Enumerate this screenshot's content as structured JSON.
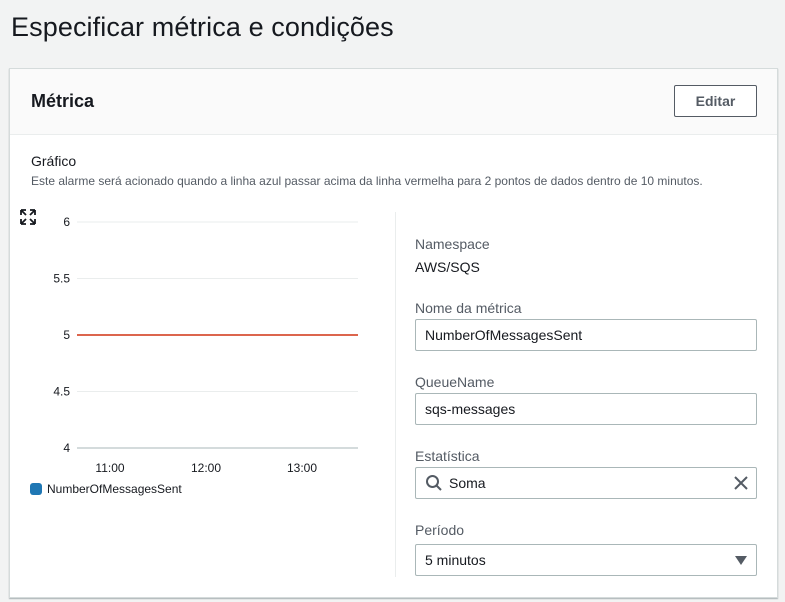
{
  "page": {
    "title": "Especificar métrica e condições"
  },
  "panel": {
    "title": "Métrica",
    "edit_label": "Editar"
  },
  "graph": {
    "title": "Gráfico",
    "description": "Este alarme será acionado quando a linha azul passar acima da linha vermelha para 2 pontos de dados dentro de 10 minutos."
  },
  "chart_data": {
    "type": "line",
    "title": "",
    "xlabel": "",
    "ylabel": "",
    "ylim": [
      4,
      6
    ],
    "y_ticks": [
      "6",
      "5.5",
      "5",
      "4.5",
      "4"
    ],
    "x_ticks": [
      "11:00",
      "12:00",
      "13:00"
    ],
    "threshold": 5,
    "threshold_color": "#d13212",
    "series": [
      {
        "name": "NumberOfMessagesSent",
        "color": "#1f77b4",
        "values": []
      }
    ],
    "legend": "bottom-left",
    "grid": true
  },
  "details": {
    "namespace_label": "Namespace",
    "namespace_value": "AWS/SQS",
    "metric_name_label": "Nome da métrica",
    "metric_name_value": "NumberOfMessagesSent",
    "queue_name_label": "QueueName",
    "queue_name_value": "sqs-messages",
    "statistic_label": "Estatística",
    "statistic_value": "Soma",
    "period_label": "Período",
    "period_value": "5 minutos"
  },
  "icons": {
    "expand": "expand-icon",
    "search": "search-icon",
    "clear": "close-icon",
    "caret": "caret-down-icon"
  }
}
